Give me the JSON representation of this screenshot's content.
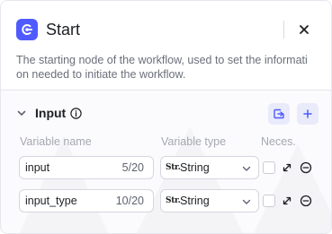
{
  "node": {
    "title": "Start",
    "description_line1": "The starting node of the workflow, used to set the informati",
    "description_line2": "on needed to initiate the workflow.",
    "icon": "start-node-icon",
    "accent_color": "#4f5bff"
  },
  "input_section": {
    "title": "Input",
    "columns": {
      "name": "Variable name",
      "type": "Variable type",
      "required": "Neces."
    },
    "rows": [
      {
        "name": "input",
        "count": "5/20",
        "type_icon": "Str.",
        "type": "String",
        "required": false
      },
      {
        "name": "input_type",
        "count": "10/20",
        "type_icon": "Str.",
        "type": "String",
        "required": false
      }
    ]
  }
}
